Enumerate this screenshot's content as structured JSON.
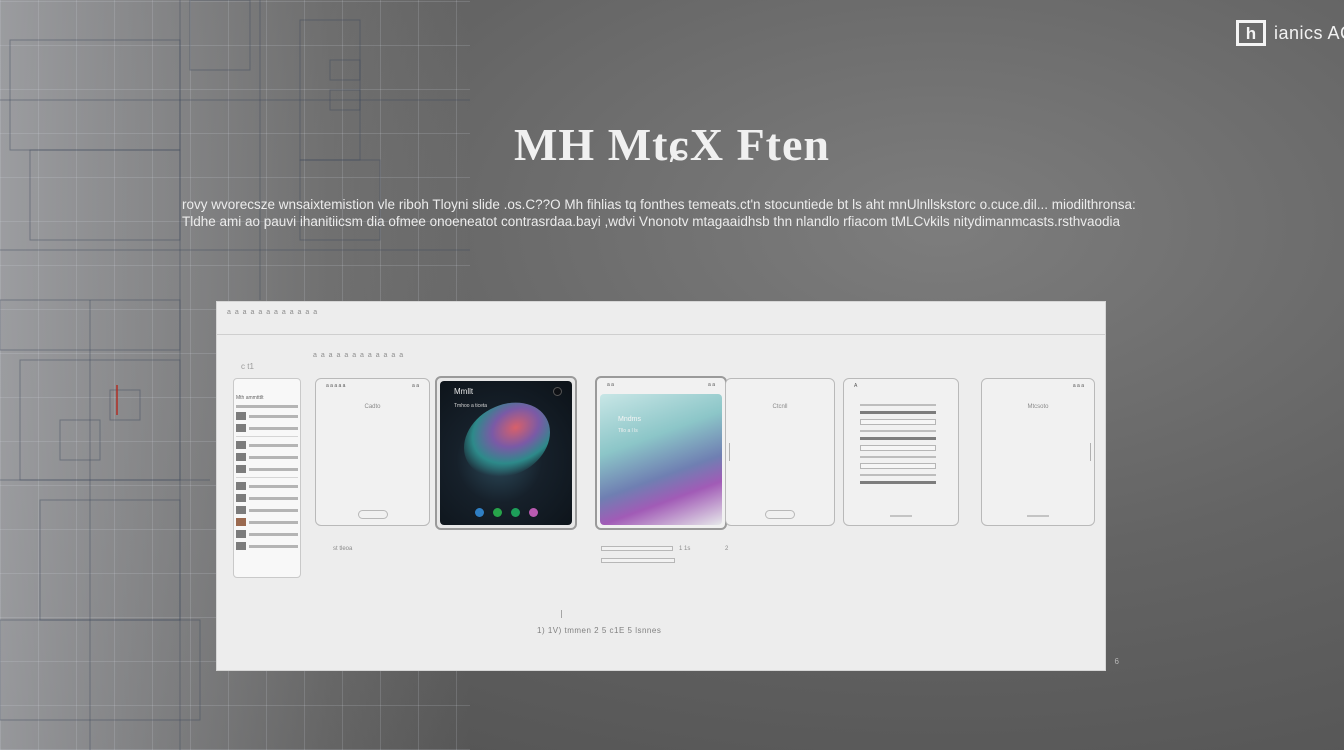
{
  "brand": {
    "mark": "h",
    "text": "ianics AC"
  },
  "hero": {
    "title": "MH MtɕX Ften",
    "description": "rovy wvorecsze wnsaixtemistion vle riboh Tloyni slide .os.C??O Mh fihlias tq fonthes temeats.ct'n stocuntiede bt ls aht mnUlnllskstorc o.cuce.dil... miodilthronsa: Tldhe ami ao pauvi ihanitiicsm dia ofmee onoeneatot contrasrdaa.bayi ,wdvi Vnonotv mtagaaidhsb thn nlandlo rfiacom tMLCvkils nitydimanmcasts.rsthvaodia"
  },
  "window": {
    "header": "a a a a a a a a a a a a",
    "breadcrumb": "a a a a a a a a a a a a",
    "meta": "c t1",
    "footer": "1) 1V) tmmen 2 5 c1E 5 lsnnes",
    "corner": "6"
  },
  "screens": {
    "list": {
      "title": "Mth ammtttlt"
    },
    "blank": {
      "status": "a a a a a",
      "status_right": "a a",
      "caption": "Cadto"
    },
    "dark": {
      "lock": "Mmllt",
      "sub": "Tmhoo a ticeta",
      "dock_colors": [
        "#2f7fc4",
        "#27a34a",
        "#1d9e59",
        "#b85ab0"
      ]
    },
    "gradient": {
      "status": "a a",
      "status_right": "a a",
      "title": "Mndms",
      "sub": "Tllo a l ls"
    },
    "middle": {
      "caption": "Ctcnll"
    },
    "form": {
      "status": "A"
    },
    "right": {
      "status_right": "a a a",
      "caption": "Mtcsoto"
    }
  },
  "below": {
    "label1": "st  tleoa",
    "label2": "1 1s",
    "label3": "2"
  }
}
